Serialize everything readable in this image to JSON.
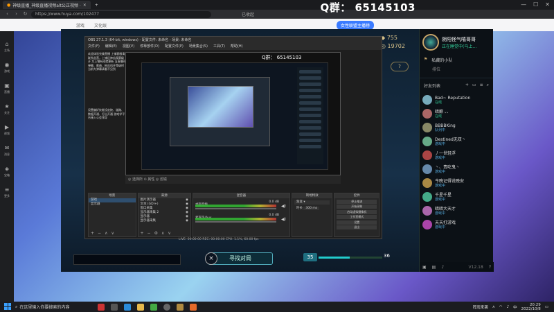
{
  "browser": {
    "tabs": [
      {
        "label": "神级直播_神级直播视频alt公正视频 ·",
        "active": true
      },
      {
        "label": "",
        "active": false
      }
    ],
    "url": "https://www.huya.com/102477",
    "status_text": "已收起",
    "watermark": "Q群： 65145103",
    "site_nav": [
      "",
      "",
      "",
      "",
      "游戏",
      "",
      "",
      "文化娱",
      ""
    ],
    "promo_button": "女性联盟主播榜"
  },
  "sidebar": [
    {
      "icon": "home-icon",
      "label": "主场"
    },
    {
      "icon": "gamepad-icon",
      "label": "游戏"
    },
    {
      "icon": "tv-icon",
      "label": "直播"
    },
    {
      "icon": "star-icon",
      "label": "关注"
    },
    {
      "icon": "video-icon",
      "label": "视频"
    },
    {
      "icon": "chat-icon",
      "label": "消息"
    },
    {
      "icon": "gift-icon",
      "label": "宝箱"
    },
    {
      "icon": "more-icon",
      "label": "更多"
    }
  ],
  "game": {
    "blue_essence": "755",
    "riot_points": "19702",
    "help_label": "?",
    "find_match": "寻找对局",
    "score_left": "35",
    "score_right": "36",
    "score_fill": 0.49
  },
  "friends": {
    "self_name": "阴阳怪气嘻哥哥",
    "self_status": "正在睡觉中(马上…",
    "tabs": [
      "私藏的小队"
    ],
    "tab_sub": "排位",
    "section_title": "好友列表",
    "list": [
      {
        "name": "Bad~ Reputation",
        "status": "在线",
        "kind": "online",
        "color": "#7ab"
      },
      {
        "name": "暗麒 、、",
        "status": "在线",
        "kind": "online",
        "color": "#a66"
      },
      {
        "name": "BBBBKing",
        "status": "队列中",
        "kind": "queue",
        "color": "#886"
      },
      {
        "name": "Destined无双丶",
        "status": "游戏中",
        "kind": "game",
        "color": "#6a8"
      },
      {
        "name": "丿一世轻浮",
        "status": "游戏中",
        "kind": "game",
        "color": "#a44"
      },
      {
        "name": "丶、责吃鬼丶",
        "status": "游戏中",
        "kind": "game",
        "color": "#68a"
      },
      {
        "name": "今晚记得说晚安",
        "status": "游戏中",
        "kind": "game",
        "color": "#a84"
      },
      {
        "name": "千星千星",
        "status": "游戏中",
        "kind": "game",
        "color": "#4a8"
      },
      {
        "name": "暗暗大天才",
        "status": "游戏中",
        "kind": "game",
        "color": "#a6a"
      },
      {
        "name": "天天打游戏",
        "status": "游戏中",
        "kind": "game",
        "color": "#a4a"
      }
    ],
    "bottom_version": "V12.18"
  },
  "obs": {
    "title": "OBS 27.1.3 (64-bit, windows) - 配置文件: 未命名 - 场景: 未命名",
    "menu": [
      "文件(F)",
      "编辑(E)",
      "视图(V)",
      "停靠部件(D)",
      "配置文件(P)",
      "场景集合(S)",
      "工具(T)",
      "帮助(H)"
    ],
    "notes_top": "欢迎体验完美直播 上铺客服请联系此直，上铺后神仙观赛级开 为上铺有成就更新 当直播间弹幕、歌曲、粉丝机开等级时 当前为弹幕请看不见到",
    "notes_bottom": "设置偏好技能设定按、道路、数据开通、打出开通 游戏学平台接入公会领导",
    "preview_watermark": "Q群： 65145103",
    "preview_bar": "◎ 选择所  ⊙ 属性   ◎ 滤镜",
    "docks": {
      "scenes_title": "场景",
      "scenes": [
        "游戏",
        "显示器"
      ],
      "sources_title": "来源",
      "sources": [
        "图片演示器",
        "文本 (GDI+)",
        "窗口采集",
        "显示器采集 2",
        "显示器",
        "显示器采集"
      ],
      "mixer_title": "混音器",
      "mixer_tracks": [
        {
          "label": "桌面音频",
          "db": "0.0 dB"
        },
        {
          "label": "麦克风/Aux",
          "db": "0.0 dB"
        }
      ],
      "transitions_title": "转场特效",
      "transition_type": "渐变",
      "duration_label": "时长",
      "duration_value": "300 ms",
      "controls_title": "控件",
      "controls": [
        "停止推流",
        "开始录制",
        "启动虚拟摄像机",
        "工作室模式",
        "设置",
        "退出"
      ]
    },
    "status": "LIVE: 00:00:00   REC: 00:00:00   CPU: 1.1%, 60.00 fps"
  },
  "taskbar": {
    "search_placeholder": "在这里输入你要搜索的内容",
    "weather": "阵雨来袭",
    "lang": "中",
    "time": "20:29",
    "date": "2022/10/8"
  }
}
